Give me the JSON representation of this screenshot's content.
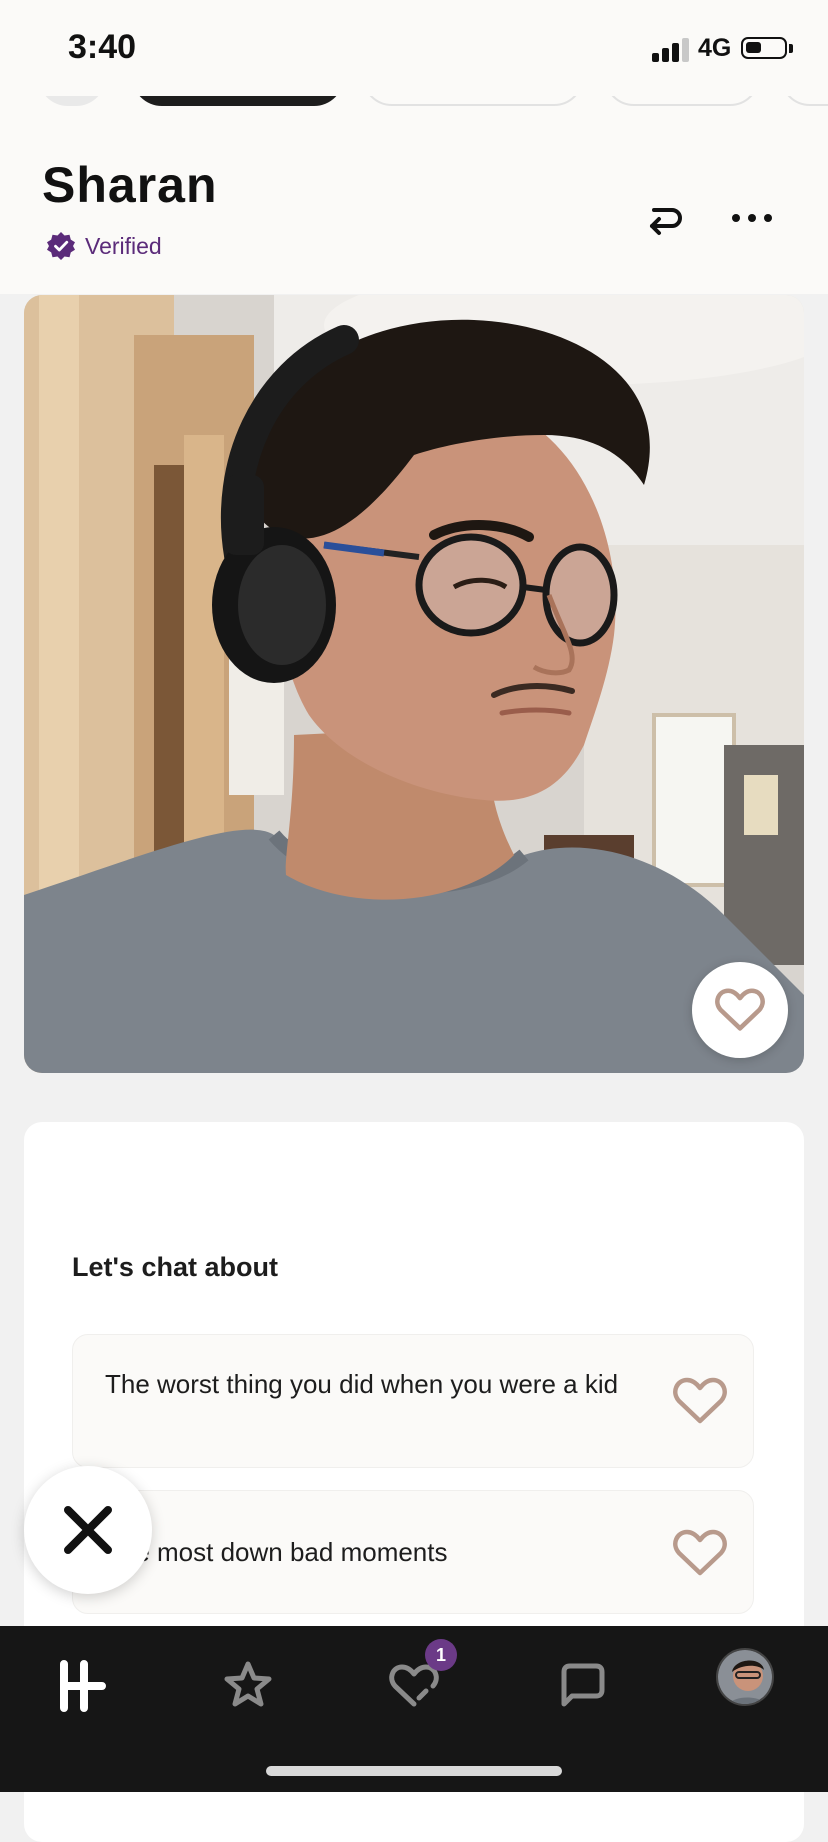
{
  "status_bar": {
    "time": "3:40",
    "network": "4G",
    "signal_bars_active": 3,
    "battery_level": 0.35
  },
  "profile": {
    "name": "Sharan",
    "verified_label": "Verified"
  },
  "prompts": {
    "title": "Let's chat about",
    "items": [
      {
        "text": "The worst thing you did when you were a kid"
      },
      {
        "text": "The most down bad moments"
      }
    ]
  },
  "tab_bar": {
    "items": [
      "home-icon",
      "star-icon",
      "likes-icon",
      "chat-icon",
      "profile-avatar"
    ],
    "likes_badge": "1"
  },
  "colors": {
    "accent_purple": "#5b2b7a",
    "heart_outline": "#b89a8c",
    "tab_bar_bg": "#161616",
    "badge_bg": "#6b3a87"
  }
}
